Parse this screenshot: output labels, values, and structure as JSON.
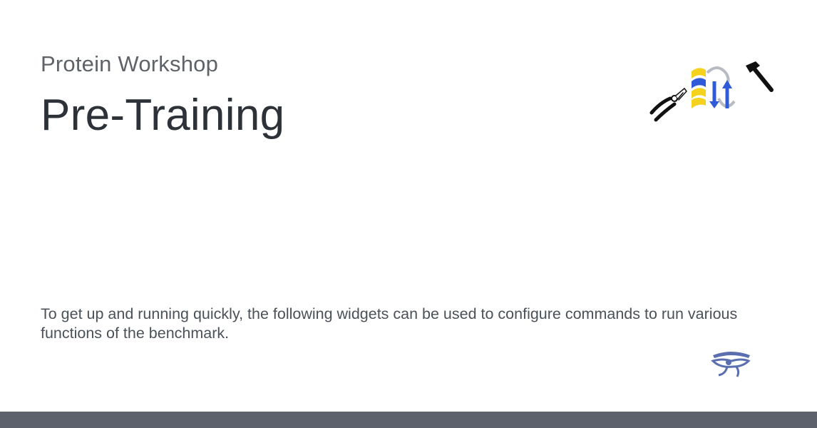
{
  "header": {
    "site_name": "Protein Workshop",
    "page_title": "Pre-Training"
  },
  "main": {
    "description": "To get up and running quickly, the following widgets can be used to configure commands to run various functions of the benchmark."
  },
  "colors": {
    "footer": "#5c616b",
    "title": "#2d3138",
    "subtitle": "#5f6368",
    "logo_blue": "#2f5bd8",
    "logo_yellow": "#f5d21d",
    "material_logo": "#5b6fb0"
  },
  "icons": {
    "project_logo": "pliers-protein-hammer-logo",
    "material_logo": "eye-of-horus-icon"
  }
}
